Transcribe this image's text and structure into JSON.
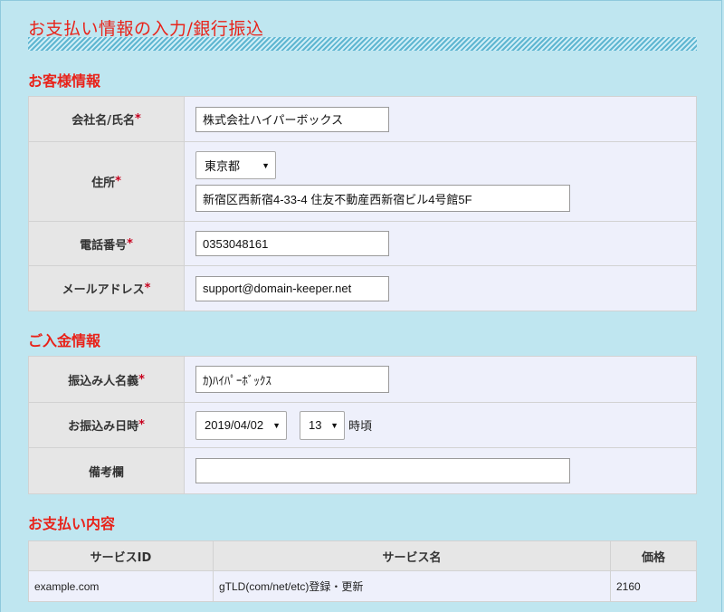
{
  "page": {
    "title": "お支払い情報の入力/銀行振込"
  },
  "customer": {
    "section_title": "お客様情報",
    "company_label": "会社名/氏名",
    "company_value": "株式会社ハイパーボックス",
    "address_label": "住所",
    "prefecture_value": "東京都",
    "address_value": "新宿区西新宿4-33-4 住友不動産西新宿ビル4号館5F",
    "phone_label": "電話番号",
    "phone_value": "0353048161",
    "email_label": "メールアドレス",
    "email_value": "support@domain-keeper.net",
    "required_mark": "*"
  },
  "payment": {
    "section_title": "ご入金情報",
    "payer_label": "振込み人名義",
    "payer_value": "ｶ)ﾊｲﾊﾟｰﾎﾞｯｸｽ",
    "date_label": "お振込み日時",
    "date_value": "2019/04/02",
    "hour_value": "13",
    "hour_unit": "時頃",
    "remarks_label": "備考欄",
    "remarks_value": ""
  },
  "summary": {
    "section_title": "お支払い内容",
    "columns": [
      "サービスID",
      "サービス名",
      "価格"
    ],
    "rows": [
      [
        "example.com",
        "gTLD(com/net/etc)登録・更新",
        "2160"
      ]
    ]
  },
  "icons": {
    "dropdown": "chevron-down-icon"
  },
  "colors": {
    "accent": "#e8231a",
    "background": "#bfe6f0",
    "label_bg": "#e6e6e6",
    "value_bg": "#eef0fb"
  }
}
